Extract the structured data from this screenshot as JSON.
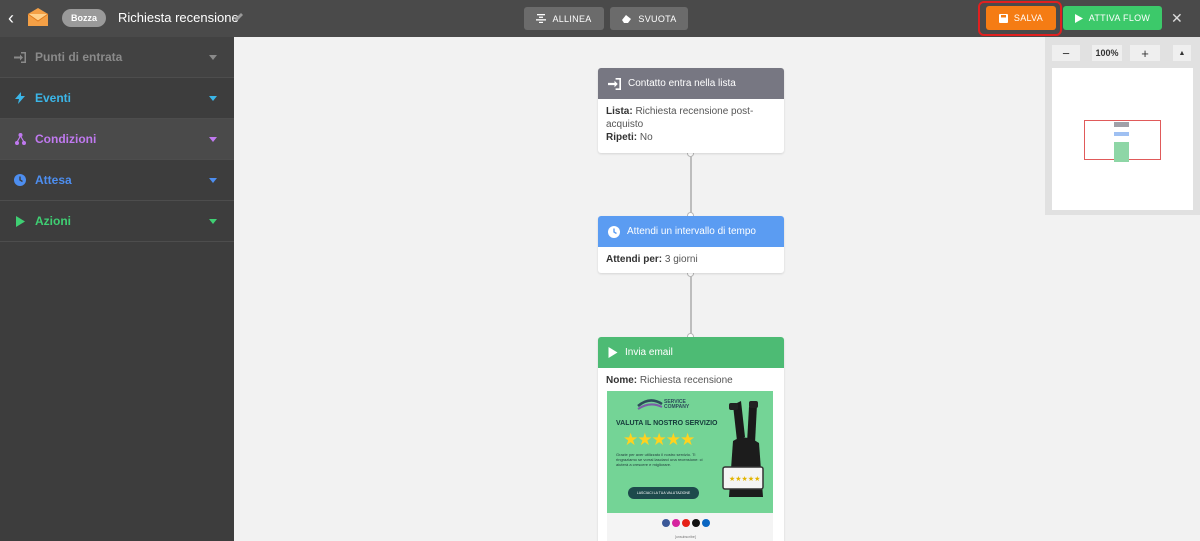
{
  "header": {
    "status_badge": "Bozza",
    "title": "Richiesta recensione",
    "align_label": "ALLINEA",
    "clear_label": "SVUOTA",
    "save_label": "SALVA",
    "activate_label": "ATTIVA FLOW",
    "close_label": "✕"
  },
  "sidebar": {
    "items": [
      {
        "label": "Punti di entrata",
        "color": "#8a8a8a"
      },
      {
        "label": "Eventi",
        "color": "#3bb6e8"
      },
      {
        "label": "Condizioni",
        "color": "#c079f0"
      },
      {
        "label": "Attesa",
        "color": "#4d8ef0"
      },
      {
        "label": "Azioni",
        "color": "#3fcf73"
      }
    ]
  },
  "flow": {
    "entry": {
      "title": "Contatto entra nella lista",
      "list_key": "Lista:",
      "list_value": "Richiesta recensione post-acquisto",
      "repeat_key": "Ripeti:",
      "repeat_value": "No"
    },
    "wait": {
      "title": "Attendi un intervallo di tempo",
      "key": "Attendi per:",
      "value": "3 giorni"
    },
    "email": {
      "title": "Invia email",
      "name_key": "Nome:",
      "name_value": "Richiesta recensione",
      "preview": {
        "brand_line1": "SERVICE",
        "brand_line2": "COMPANY",
        "heading": "VALUTA IL NOSTRO SERVIZIO",
        "stars": "★★★★★",
        "body": "Grazie per aver utilizzato il nostro servizio. Ti ringraziamo se vorrai lasciarci una recensione: ci aiuterà a crescere e migliorare.",
        "button": "LASCIACI LA TUA VALUTAZIONE",
        "footer": "[unsubscribe]"
      }
    }
  },
  "minimap": {
    "minus": "−",
    "zoom": "100%",
    "plus": "+",
    "collapse": "▲"
  },
  "colors": {
    "topbar": "#4a4a4a",
    "save": "#f57c14",
    "activate": "#3cc96a",
    "annotation": "#e11111"
  }
}
